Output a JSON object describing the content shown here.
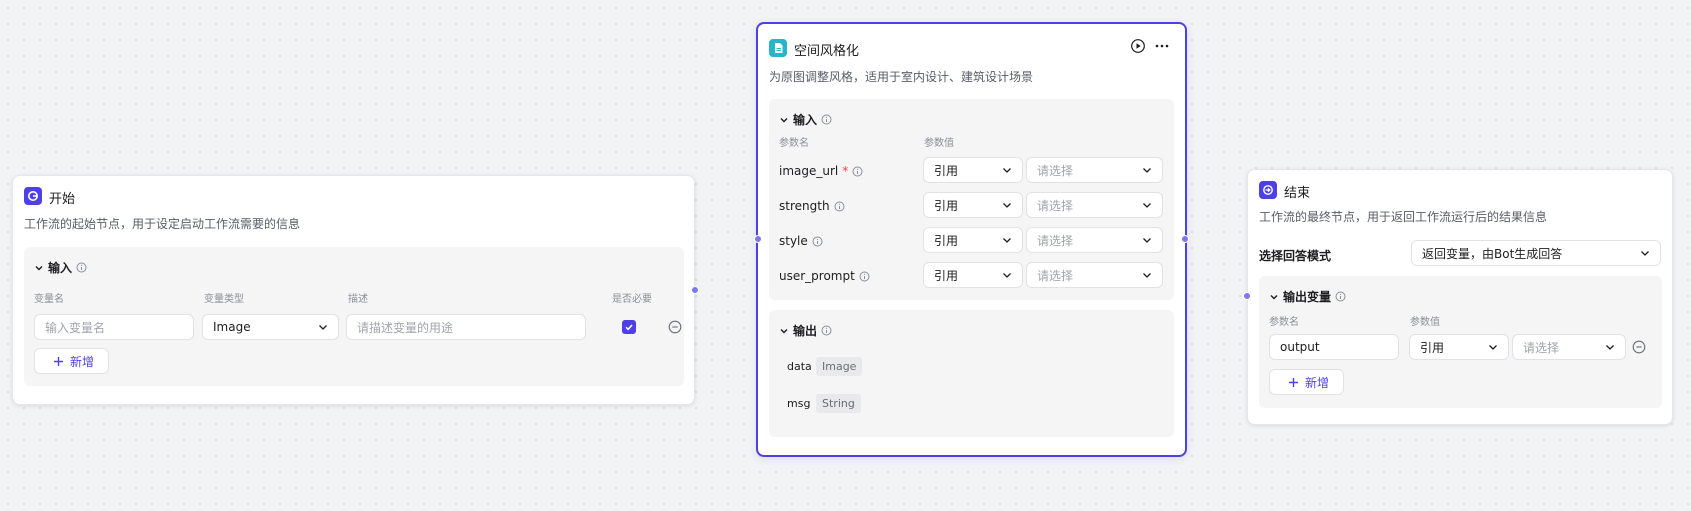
{
  "colors": {
    "accent": "#4e40e5",
    "start_icon": "#4e40e5",
    "style_icon": "#26b5c9",
    "end_icon": "#4e40e5"
  },
  "start_node": {
    "title": "开始",
    "desc": "工作流的起始节点，用于设定启动工作流需要的信息",
    "input_section": {
      "title": "输入",
      "col_name": "变量名",
      "col_type": "变量类型",
      "col_desc": "描述",
      "col_required": "是否必要",
      "row": {
        "name_placeholder": "输入变量名",
        "type_value": "Image",
        "desc_placeholder": "请描述变量的用途",
        "required": true
      },
      "add_label": "新增"
    }
  },
  "style_node": {
    "title": "空间风格化",
    "desc": "为原图调整风格，适用于室内设计、建筑设计场景",
    "input_section": {
      "title": "输入",
      "col_name": "参数名",
      "col_value": "参数值",
      "params": [
        {
          "name": "image_url",
          "required": true,
          "mode": "引用",
          "placeholder": "请选择"
        },
        {
          "name": "strength",
          "required": false,
          "mode": "引用",
          "placeholder": "请选择"
        },
        {
          "name": "style",
          "required": false,
          "mode": "引用",
          "placeholder": "请选择"
        },
        {
          "name": "user_prompt",
          "required": false,
          "mode": "引用",
          "placeholder": "请选择"
        }
      ]
    },
    "output_section": {
      "title": "输出",
      "outputs": [
        {
          "name": "data",
          "type": "Image"
        },
        {
          "name": "msg",
          "type": "String"
        }
      ]
    }
  },
  "end_node": {
    "title": "结束",
    "desc": "工作流的最终节点，用于返回工作流运行后的结果信息",
    "mode_label": "选择回答模式",
    "mode_value": "返回变量，由Bot生成回答",
    "output_section": {
      "title": "输出变量",
      "col_name": "参数名",
      "col_value": "参数值",
      "row": {
        "name_value": "output",
        "mode": "引用",
        "placeholder": "请选择"
      },
      "add_label": "新增"
    }
  }
}
